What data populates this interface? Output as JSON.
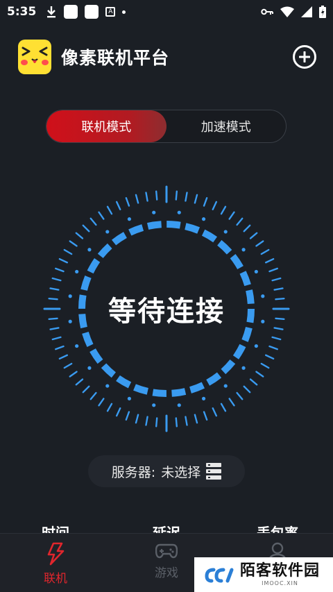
{
  "status_bar": {
    "time": "5:35"
  },
  "header": {
    "app_title": "像素联机平台"
  },
  "mode_switch": {
    "tabs": [
      {
        "label": "联机模式",
        "active": true
      },
      {
        "label": "加速模式",
        "active": false
      }
    ]
  },
  "dial": {
    "status_text": "等待连接",
    "accent_color": "#3a9bf0"
  },
  "server": {
    "label": "服务器:",
    "value": "未选择"
  },
  "stats": {
    "labels": [
      "时间",
      "延迟",
      "丢包率"
    ]
  },
  "bottom_nav": {
    "items": [
      {
        "label": "联机",
        "icon": "lightning-icon",
        "active": true
      },
      {
        "label": "游戏",
        "icon": "gamepad-icon",
        "active": false
      },
      {
        "label": "",
        "icon": "user-icon",
        "active": false
      }
    ]
  },
  "watermark": {
    "main": "陌客软件园",
    "sub": "IMOOC.XIN"
  },
  "colors": {
    "background": "#1b1f25",
    "active_red": "#e0262d",
    "dial_blue": "#3a9bf0"
  }
}
